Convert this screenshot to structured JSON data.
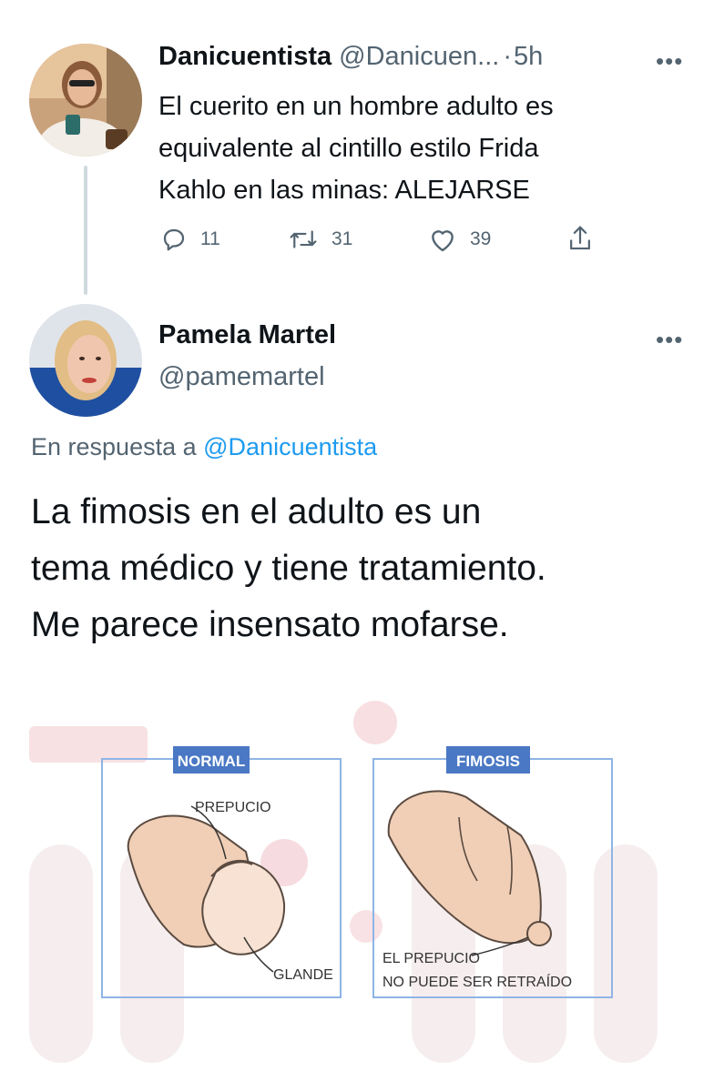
{
  "tweet1": {
    "display_name": "Danicuentista",
    "handle": "@Danicuen...",
    "separator": "·",
    "time": "5h",
    "more_icon": "more-horizontal-icon",
    "text_lines": [
      "El cuerito en un hombre adulto es",
      "equivalente al cintillo estilo Frida",
      "Kahlo en las minas: ALEJARSE"
    ],
    "actions": {
      "replies": "11",
      "retweets": "31",
      "likes": "39"
    }
  },
  "tweet2": {
    "display_name": "Pamela Martel",
    "handle": "@pamemartel",
    "more_icon": "more-horizontal-icon",
    "reply_to_prefix": "En respuesta a",
    "reply_to_handle": "@Danicuentista",
    "text_lines": [
      "La fimosis en el adulto es un",
      "tema médico y tiene tratamiento.",
      "Me parece insensato mofarse."
    ]
  },
  "figure": {
    "panel_normal": {
      "title": "NORMAL",
      "label_top": "PREPUCIO",
      "label_bottom": "GLANDE"
    },
    "panel_fimosis": {
      "title": "FIMOSIS",
      "label_line1": "EL PREPUCIO",
      "label_line2": "NO PUEDE SER RETRAÍDO"
    }
  },
  "colors": {
    "link": "#1d9bf0",
    "muted": "#536471",
    "panel_border": "#8fb4e6",
    "panel_title_bg": "#4a78c4",
    "skin": "#f0cfb6",
    "skin_outline": "#5a4a40"
  }
}
